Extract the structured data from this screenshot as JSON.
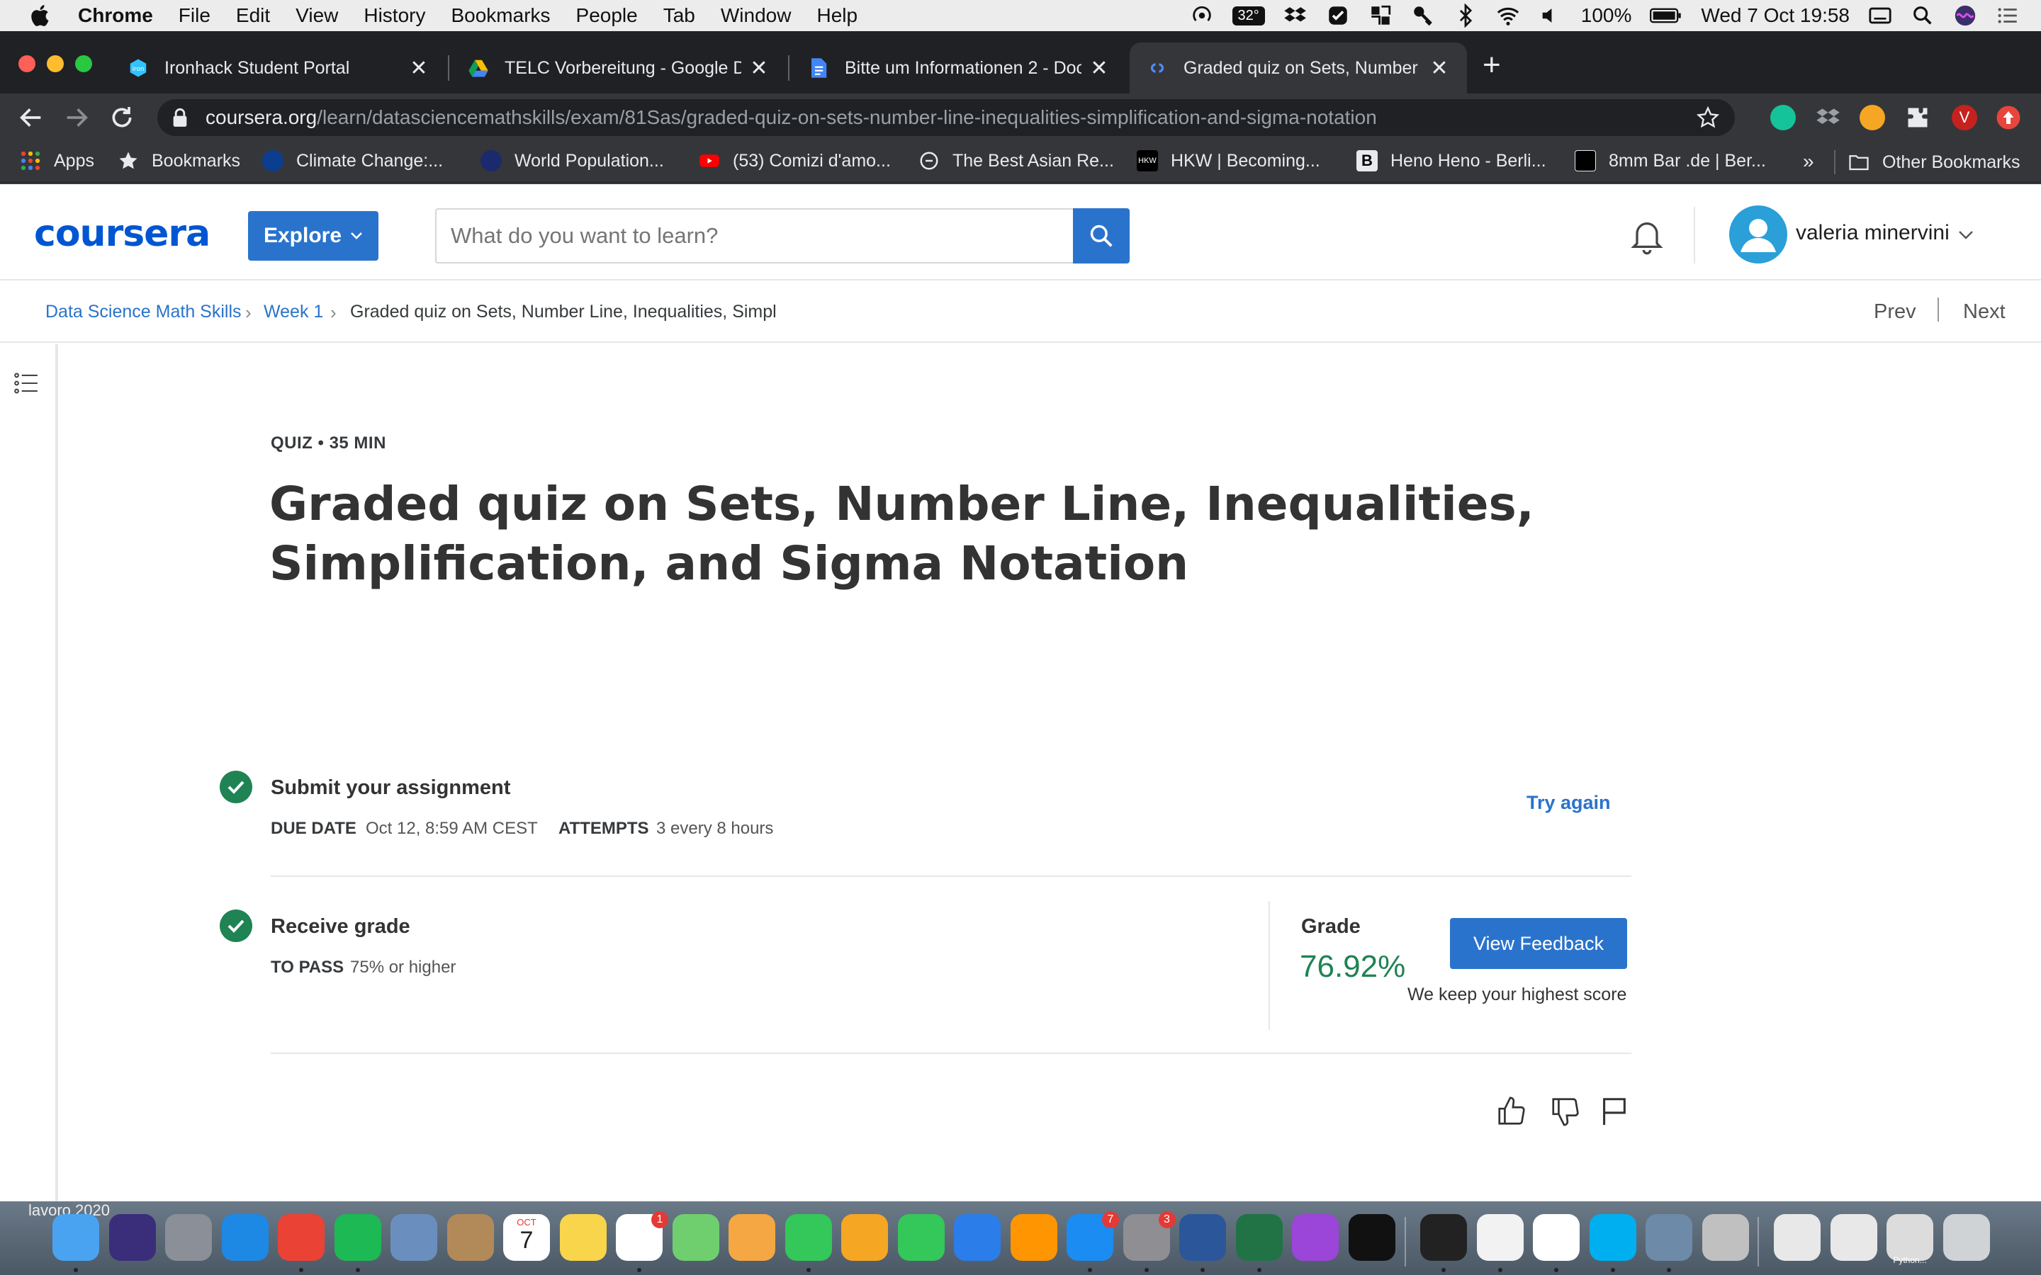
{
  "menubar": {
    "app_name": "Chrome",
    "items": [
      "File",
      "Edit",
      "View",
      "History",
      "Bookmarks",
      "People",
      "Tab",
      "Window",
      "Help"
    ],
    "temperature": "32°",
    "battery": "100%",
    "datetime": "Wed 7 Oct  19:58"
  },
  "tabs": [
    {
      "title": "Ironhack Student Portal",
      "icon": "ironhack-icon"
    },
    {
      "title": "TELC Vorbereitung - Google Dr",
      "icon": "google-drive-icon"
    },
    {
      "title": "Bitte um Informationen 2 - Doc",
      "icon": "google-docs-icon"
    },
    {
      "title": "Graded quiz on Sets, Number L",
      "icon": "coursera-icon",
      "active": true
    }
  ],
  "address": {
    "host": "coursera.org",
    "path": "/learn/datasciencemathskills/exam/81Sas/graded-quiz-on-sets-number-line-inequalities-simplification-and-sigma-notation"
  },
  "extensions": {
    "profile_initial": "V"
  },
  "bookmarks": [
    {
      "label": "Apps",
      "icon": "apps-grid-icon"
    },
    {
      "label": "Bookmarks",
      "icon": "star-icon"
    },
    {
      "label": "Climate Change:...",
      "icon": "nasa-icon"
    },
    {
      "label": "World Population...",
      "icon": "data-icon"
    },
    {
      "label": "(53) Comizi d'amo...",
      "icon": "youtube-icon"
    },
    {
      "label": "The Best Asian Re...",
      "icon": "e-logo-icon"
    },
    {
      "label": "HKW | Becoming...",
      "icon": "hkw-icon"
    },
    {
      "label": "Heno Heno - Berli...",
      "icon": "b-logo-icon"
    },
    {
      "label": "8mm Bar .de | Ber...",
      "icon": "8mm-icon"
    }
  ],
  "bookmarks_overflow": "»",
  "other_bookmarks": "Other Bookmarks",
  "header": {
    "logo": "coursera",
    "explore_label": "Explore",
    "search_placeholder": "What do you want to learn?",
    "user_name": "valeria minervini"
  },
  "breadcrumb": {
    "course": "Data Science Math Skills",
    "week": "Week 1",
    "current": "Graded quiz on Sets, Number Line, Inequalities, Simpl",
    "prev": "Prev",
    "next": "Next"
  },
  "quiz": {
    "eyebrow": "QUIZ • 35 MIN",
    "title_line1": "Graded quiz on Sets, Number Line, Inequalities,",
    "title_line2": "Simplification, and Sigma Notation",
    "submit": {
      "title": "Submit your assignment",
      "due_key": "DUE DATE",
      "due_value": "Oct 12, 8:59 AM CEST",
      "attempts_key": "ATTEMPTS",
      "attempts_value": "3 every 8 hours",
      "try_again": "Try again"
    },
    "receive": {
      "title": "Receive grade",
      "pass_key": "TO PASS",
      "pass_value": "75% or higher",
      "grade_label": "Grade",
      "grade_value": "76.92%",
      "view_feedback": "View Feedback",
      "keep_note": "We keep your highest score"
    }
  },
  "desktop_text": "lavoro 2020",
  "dock": {
    "items": [
      "finder",
      "siri",
      "launchpad",
      "safari",
      "chrome",
      "spotify",
      "preview-bird",
      "contacts",
      "calendar",
      "notes",
      "reminders",
      "maps",
      "photos",
      "messages",
      "pages",
      "numbers",
      "keynote",
      "books",
      "app-store",
      "system-preferences",
      "word",
      "excel",
      "podcasts",
      "apple-tv",
      "terminal",
      "textedit",
      "slack",
      "skype",
      "image-capture",
      "disk-utility",
      "documents",
      "downloads",
      "python-window",
      "trash"
    ],
    "calendar_month": "OCT",
    "calendar_day": "7",
    "badges": {
      "reminders": "1",
      "app_store": "7",
      "system_preferences": "3"
    },
    "python_label": "Python..."
  },
  "colors": {
    "coursera_blue": "#0056d2",
    "button_blue": "#2a73cc",
    "success_green": "#1f8354"
  }
}
